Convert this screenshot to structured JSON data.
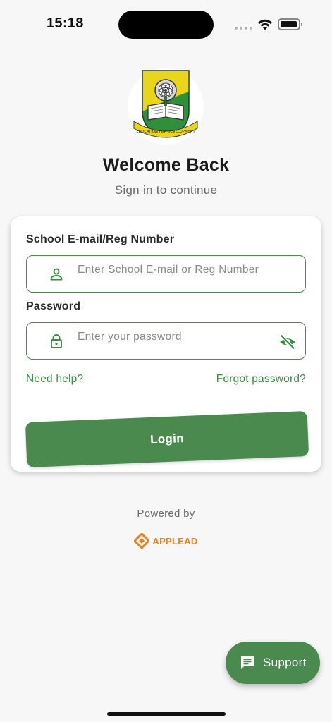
{
  "status_bar": {
    "time": "15:18"
  },
  "header": {
    "title": "Welcome Back",
    "subtitle": "Sign in to continue",
    "logo_text": "EDUCATION FOR DEVELOPMENT"
  },
  "form": {
    "email_label": "School E-mail/Reg Number",
    "email_placeholder": "Enter School E-mail or Reg Number",
    "email_icon": "person-icon",
    "password_label": "Password",
    "password_placeholder": "Enter your password",
    "password_icon": "lock-icon",
    "visibility_icon": "eye-off-icon",
    "need_help": "Need help?",
    "forgot_password": "Forgot password?",
    "login_label": "Login"
  },
  "footer": {
    "powered_by": "Powered by",
    "brand_name": "APPLEAD"
  },
  "support": {
    "label": "Support",
    "icon": "chat-icon"
  },
  "colors": {
    "primary": "#4a8a4f",
    "link": "#3e8a47",
    "brand_orange": "#e8821e",
    "background": "#f7f7f7"
  }
}
